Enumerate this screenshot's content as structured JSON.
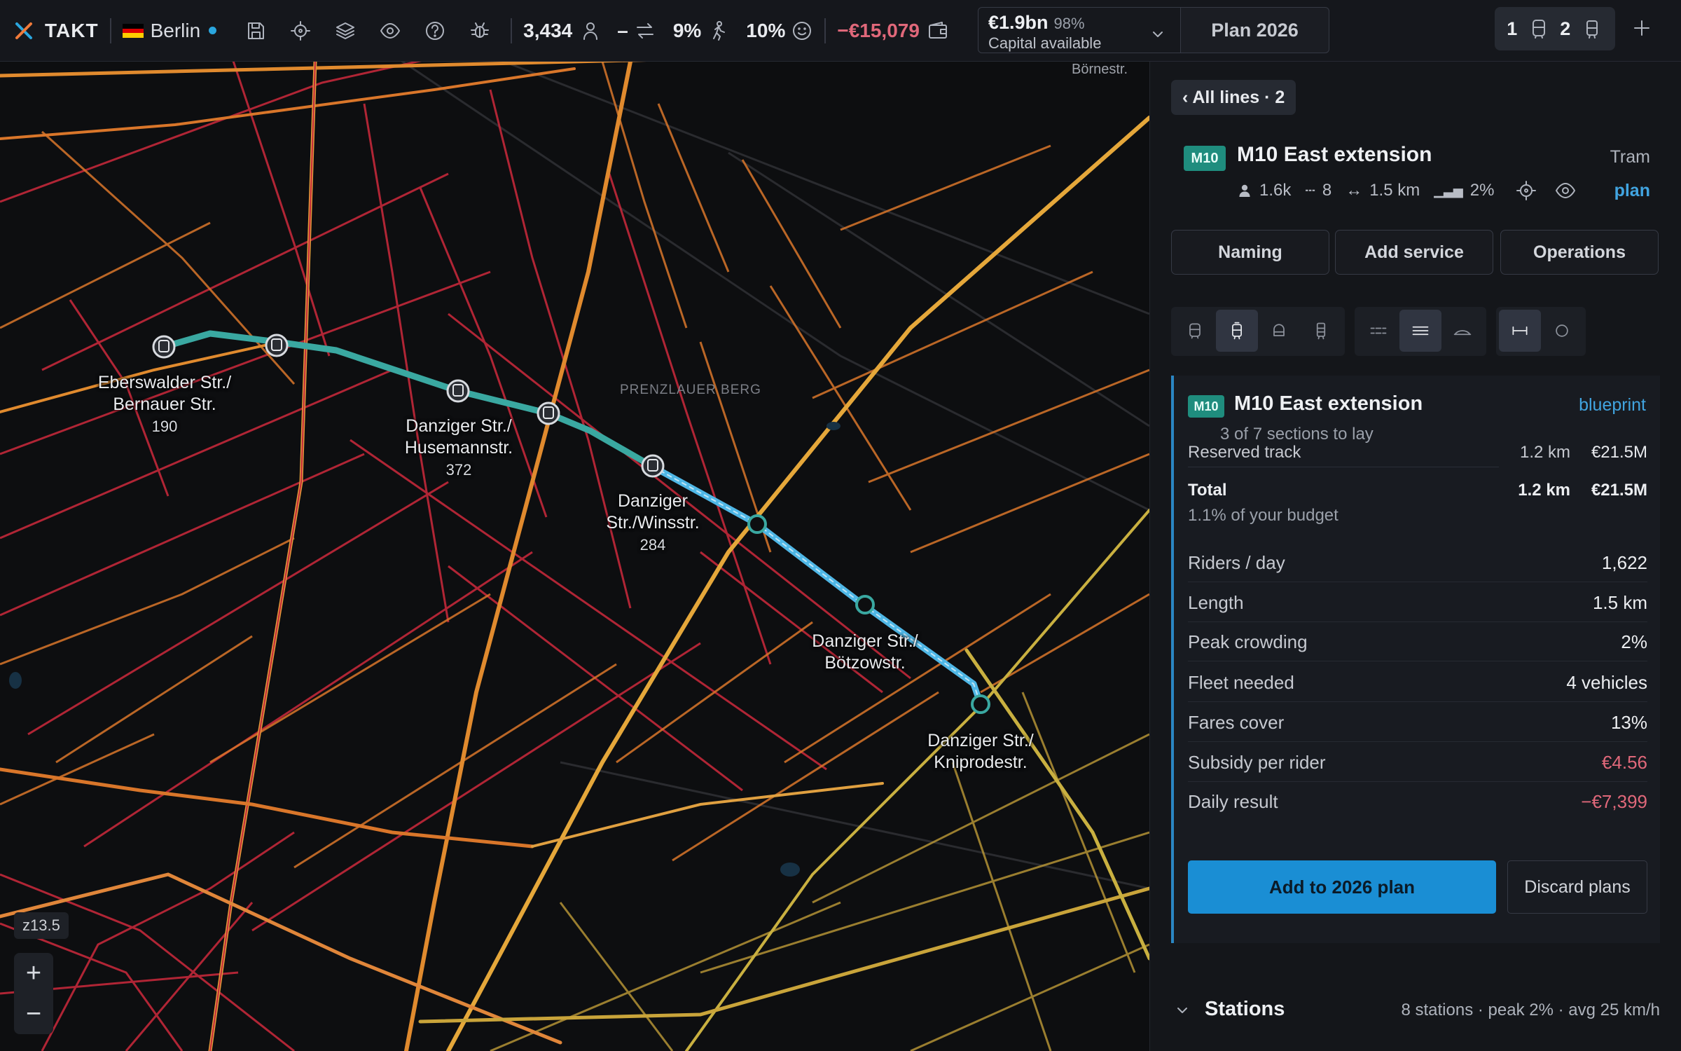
{
  "app": {
    "name": "TAKT",
    "city": "Berlin",
    "icons": [
      "save-icon",
      "locate-icon",
      "layers-icon",
      "eye-icon",
      "help-icon",
      "bug-icon"
    ]
  },
  "stats": {
    "riders": "3,434",
    "transfer_symbol": "–",
    "walk_pct": "9%",
    "satisfaction_pct": "10%",
    "cash_flow": "−€15,079"
  },
  "capital": {
    "value": "€1.9bn",
    "pct": "98%",
    "label": "Capital available"
  },
  "plan_year": "Plan 2026",
  "modes": {
    "bus_count": "1",
    "tram_count": "2"
  },
  "map": {
    "zoom": "z13.5",
    "district": "PRENZLAUER BERG",
    "street_top": "Börnestr.",
    "stations": [
      {
        "l1": "Eberswalder Str./",
        "l2": "Bernauer Str.",
        "count": "190"
      },
      {
        "l1": "Danziger Str./",
        "l2": "Husemannstr.",
        "count": "372"
      },
      {
        "l1": "Danziger",
        "l2": "Str./Winsstr.",
        "count": "284"
      },
      {
        "l1": "Danziger Str./",
        "l2": "Bötzowstr.",
        "count": ""
      },
      {
        "l1": "Danziger Str./",
        "l2": "Kniprodestr.",
        "count": ""
      }
    ],
    "colors": {
      "line": "#3aa8a1",
      "planned": "#4fb7e6"
    }
  },
  "panel": {
    "back": "‹ All lines · 2",
    "line_code": "M10",
    "line_name": "M10 East extension",
    "mode": "Tram",
    "status": "plan",
    "header_stats": {
      "riders": "1.6k",
      "stops": "8",
      "length": "1.5 km",
      "crowding": "2%"
    },
    "actions": [
      "Naming",
      "Add service",
      "Operations"
    ],
    "blueprint": {
      "tag": "blueprint",
      "progress": "3 of 7 sections to lay",
      "costs": [
        {
          "label": "Reserved track",
          "km": "1.2 km",
          "amount": "€21.5M"
        },
        {
          "label": "Total",
          "km": "1.2 km",
          "amount": "€21.5M"
        }
      ],
      "budget_note": "1.1% of your budget",
      "metrics": [
        {
          "label": "Riders / day",
          "value": "1,622"
        },
        {
          "label": "Length",
          "value": "1.5 km"
        },
        {
          "label": "Peak crowding",
          "value": "2%"
        },
        {
          "label": "Fleet needed",
          "value": "4 vehicles"
        },
        {
          "label": "Fares cover",
          "value": "13%"
        },
        {
          "label": "Subsidy per rider",
          "value": "€4.56"
        },
        {
          "label": "Daily result",
          "value": "−€7,399"
        }
      ],
      "primary": "Add to 2026 plan",
      "secondary": "Discard plans"
    },
    "stations": {
      "title": "Stations",
      "summary": "8 stations · peak 2% · avg 25 km/h"
    }
  },
  "accent": "#1a8ed4"
}
